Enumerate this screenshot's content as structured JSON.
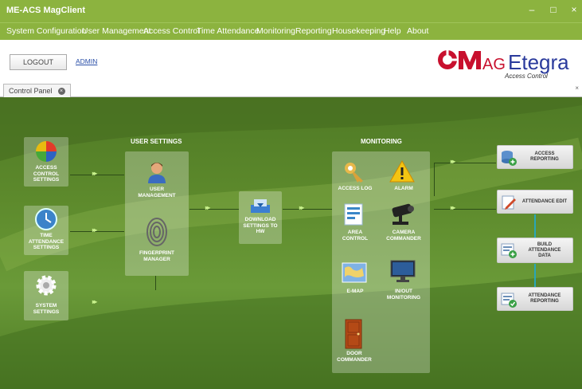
{
  "window": {
    "title": "ME-ACS MagClient",
    "controls": [
      "–",
      "□",
      "×"
    ]
  },
  "menu": [
    "System Configuration",
    "User Management",
    "Access Control",
    "Time Attendance",
    "Monitoring",
    "Reporting",
    "Housekeeping",
    "Help",
    "About"
  ],
  "session": {
    "logout_label": "LOGOUT",
    "user_link": "ADMIN"
  },
  "logo": {
    "brand": "MAGEtegra",
    "brand_m": "M",
    "brand_ag": "AG",
    "brand_etegra": "Etegra",
    "tagline": "Access Control"
  },
  "tabs": [
    {
      "label": "Control Panel",
      "close": "×"
    }
  ],
  "panel_close": "×",
  "control_panel": {
    "left": [
      {
        "l1": "ACCESS",
        "l2": "CONTROL",
        "l3": "SETTINGS"
      },
      {
        "l1": "TIME",
        "l2": "ATTENDANCE",
        "l3": "SETTINGS"
      },
      {
        "l1": "SYSTEM",
        "l2": "SETTINGS"
      }
    ],
    "user_settings": {
      "title": "USER SETTINGS",
      "items": [
        {
          "l1": "USER",
          "l2": "MANAGEMENT"
        },
        {
          "l1": "FINGERPRINT",
          "l2": "MANAGER"
        }
      ]
    },
    "download": {
      "l1": "DOWNLOAD",
      "l2": "SETTINGS TO",
      "l3": "HW"
    },
    "monitoring": {
      "title": "MONITORING",
      "items": [
        {
          "l1": "ACCESS LOG"
        },
        {
          "l1": "ALARM"
        },
        {
          "l1": "AREA",
          "l2": "CONTROL"
        },
        {
          "l1": "CAMERA",
          "l2": "COMMANDER"
        },
        {
          "l1": "E-MAP"
        },
        {
          "l1": "IN/OUT",
          "l2": "MONITORING"
        },
        {
          "l1": "DOOR",
          "l2": "COMMANDER"
        }
      ]
    },
    "reports": [
      {
        "l1": "ACCESS",
        "l2": "REPORTING"
      },
      {
        "l1": "ATTENDANCE EDIT"
      },
      {
        "l1": "BUILD",
        "l2": "ATTENDANCE",
        "l3": "DATA"
      },
      {
        "l1": "ATTENDANCE",
        "l2": "REPORTING"
      }
    ],
    "arrow": "▸▸"
  },
  "colors": {
    "titlebar": "#8cb33f",
    "panel": "#5d8a2c",
    "logo_red": "#c8102e",
    "logo_blue": "#2a3a9c"
  }
}
